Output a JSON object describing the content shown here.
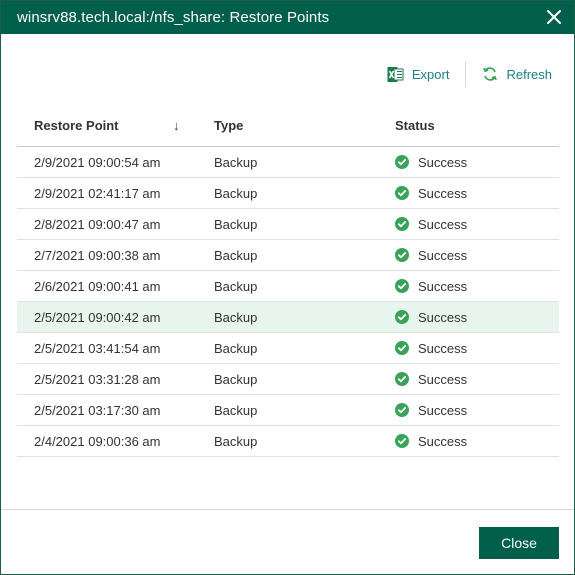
{
  "dialog": {
    "title": "winsrv88.tech.local:/nfs_share: Restore Points",
    "close_button_label": "Close"
  },
  "toolbar": {
    "export_label": "Export",
    "refresh_label": "Refresh"
  },
  "table": {
    "columns": {
      "restore_point": "Restore Point",
      "type": "Type",
      "status": "Status"
    },
    "sort_indicator": "↓",
    "rows": [
      {
        "restore_point": "2/9/2021 09:00:54 am",
        "type": "Backup",
        "status": "Success"
      },
      {
        "restore_point": "2/9/2021 02:41:17 am",
        "type": "Backup",
        "status": "Success"
      },
      {
        "restore_point": "2/8/2021 09:00:47 am",
        "type": "Backup",
        "status": "Success"
      },
      {
        "restore_point": "2/7/2021 09:00:38 am",
        "type": "Backup",
        "status": "Success"
      },
      {
        "restore_point": "2/6/2021 09:00:41 am",
        "type": "Backup",
        "status": "Success"
      },
      {
        "restore_point": "2/5/2021 09:00:42 am",
        "type": "Backup",
        "status": "Success"
      },
      {
        "restore_point": "2/5/2021 03:41:54 am",
        "type": "Backup",
        "status": "Success"
      },
      {
        "restore_point": "2/5/2021 03:31:28 am",
        "type": "Backup",
        "status": "Success"
      },
      {
        "restore_point": "2/5/2021 03:17:30 am",
        "type": "Backup",
        "status": "Success"
      },
      {
        "restore_point": "2/4/2021 09:00:36 am",
        "type": "Backup",
        "status": "Success"
      }
    ],
    "selected_row_index": 5
  },
  "colors": {
    "brand": "#005f4b",
    "link": "#1b7d8c",
    "success": "#3aa35a",
    "selected_row": "#e8f5ee"
  },
  "icons": {
    "export": "excel-icon",
    "refresh": "refresh-icon",
    "status": "check-circle-icon",
    "close": "close-icon"
  }
}
